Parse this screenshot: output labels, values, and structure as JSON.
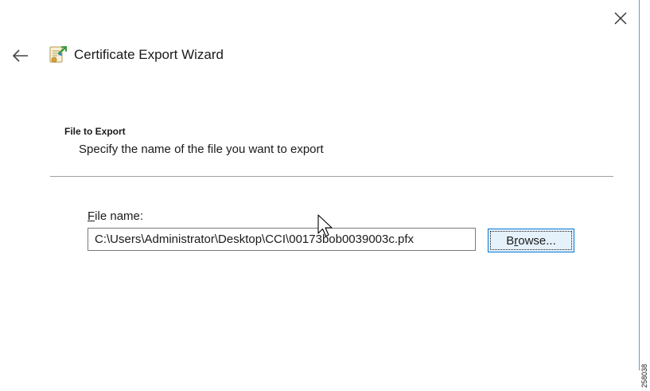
{
  "window": {
    "title": "Certificate Export Wizard",
    "close_glyph": "×",
    "back_icon": "back-arrow-icon",
    "wizard_icon": "certificate-wizard-icon"
  },
  "page": {
    "heading": "File to Export",
    "description": "Specify the name of the file you want to export"
  },
  "file_field": {
    "label_mnemonic": "F",
    "label_rest": "ile name:",
    "value": "C:\\Users\\Administrator\\Desktop\\CCI\\00173bob0039003c.pfx"
  },
  "browse_button": {
    "label_pre": "B",
    "label_mnemonic": "r",
    "label_post": "owse..."
  },
  "figure_number": "258038",
  "colors": {
    "accent": "#0078d7",
    "window_border": "#5b9bd5",
    "button_background": "#e5f1fb"
  }
}
